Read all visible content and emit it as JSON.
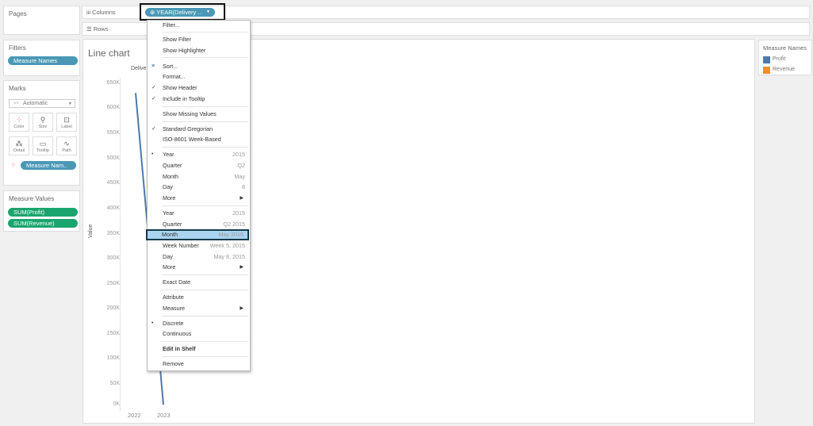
{
  "pages": {
    "title": "Pages"
  },
  "filters": {
    "title": "Filters",
    "pill": "Measure Names"
  },
  "marks": {
    "title": "Marks",
    "type_select": "Automatic",
    "buttons": [
      "Color",
      "Size",
      "Label",
      "Detail",
      "Tooltip",
      "Path"
    ],
    "color_pill": "Measure Nam.."
  },
  "measure_values": {
    "title": "Measure Values",
    "pills": [
      "SUM(Profit)",
      "SUM(Revenue)"
    ]
  },
  "shelves": {
    "columns_label": "Columns",
    "rows_label": "Rows",
    "column_pill": "YEAR(Delivery ..",
    "column_pill_icon": "plus-icon"
  },
  "sheet": {
    "title": "Line chart",
    "header_field": "Delive",
    "ylabel": "Value"
  },
  "chart_data": {
    "type": "line",
    "title": "Line chart",
    "xlabel": "Delive",
    "ylabel": "Value",
    "y_ticks": [
      "0K",
      "50K",
      "100K",
      "150K",
      "200K",
      "250K",
      "300K",
      "350K",
      "400K",
      "450K",
      "500K",
      "550K",
      "600K",
      "650K"
    ],
    "ylim": [
      0,
      650000
    ],
    "categories": [
      "2022",
      "2023"
    ],
    "series": [
      {
        "name": "Profit",
        "color": "#4e79a7",
        "values": [
          630000,
          0
        ]
      }
    ]
  },
  "legend": {
    "title": "Measure Names",
    "items": [
      {
        "label": "Profit",
        "color": "#4e79a7"
      },
      {
        "label": "Revenue",
        "color": "#f28e2b"
      }
    ]
  },
  "menu": {
    "items": [
      {
        "label": "Filter...",
        "top": 0
      },
      {
        "label": "Show Filter"
      },
      {
        "label": "Show Highlighter"
      },
      {
        "label": "Sort..."
      },
      {
        "label": "Format..."
      },
      {
        "label": "Show Header",
        "checked": true
      },
      {
        "label": "Include in Tooltip",
        "checked": true
      },
      {
        "label": "Show Missing Values"
      },
      {
        "label": "Standard Gregorian",
        "checked": true
      },
      {
        "label": "ISO-8601 Week-Based"
      },
      {
        "label": "Year",
        "value": "2015",
        "bullet": true
      },
      {
        "label": "Quarter",
        "value": "Q2"
      },
      {
        "label": "Month",
        "value": "May"
      },
      {
        "label": "Day",
        "value": "8"
      },
      {
        "label": "More",
        "submenu": true
      },
      {
        "label": "Year",
        "value": "2015"
      },
      {
        "label": "Quarter",
        "value": "Q2 2015"
      },
      {
        "label": "Month",
        "value": "May 2015",
        "highlighted": true
      },
      {
        "label": "Week Number",
        "value": "Week 5, 2015"
      },
      {
        "label": "Day",
        "value": "May 8, 2015"
      },
      {
        "label": "More",
        "submenu": true
      },
      {
        "label": "Exact Date"
      },
      {
        "label": "Attribute"
      },
      {
        "label": "Measure",
        "submenu": true
      },
      {
        "label": "Discrete",
        "bullet": true
      },
      {
        "label": "Continuous"
      },
      {
        "label": "Edit in Shelf",
        "bold": true
      },
      {
        "label": "Remove"
      }
    ]
  }
}
